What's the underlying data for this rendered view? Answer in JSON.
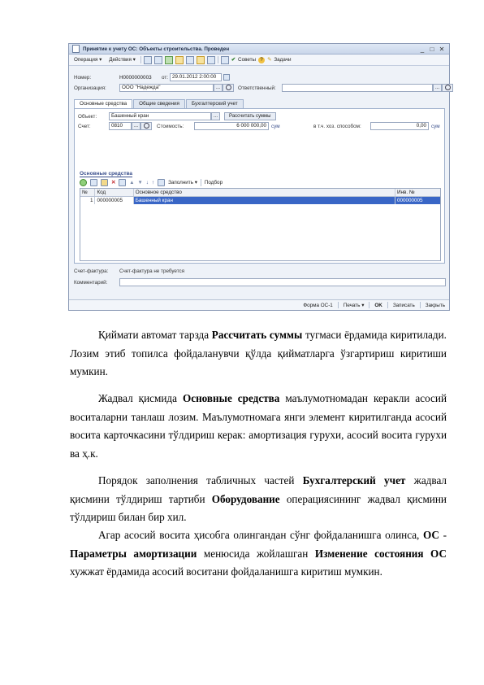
{
  "window": {
    "title": "Принятие к учету ОС: Объекты строительства. Проведен",
    "controls": [
      "_",
      "□",
      "✕"
    ]
  },
  "toolbar": {
    "operation": "Операция ▾",
    "actions": "Действия ▾",
    "advice": "Советы",
    "tasks": "Задачи"
  },
  "form": {
    "number_label": "Номер:",
    "number_value": "Н0000000003",
    "date_label": "от:",
    "date_value": "29.01.2012  2:00:00",
    "org_label": "Организация:",
    "org_value": "ООО \"Надежда\"",
    "responsible_label": "Ответственный:",
    "responsible_value": ""
  },
  "tabs": [
    "Основные средства",
    "Общие сведения",
    "Бухгалтерский учет"
  ],
  "panel": {
    "object_label": "Объект:",
    "object_value": "Башенный кран",
    "calc_button": "Рассчитать суммы",
    "account_label": "Счет:",
    "account_value": "0810",
    "cost_label": "Стоимость:",
    "cost_value": "6 000 000,00",
    "cost_currency": "сум",
    "household_label": "в т.ч. хоз. способом:",
    "household_value": "0,00",
    "household_currency": "сум",
    "section_title": "Основные средства",
    "fill_menu": "Заполнить ▾",
    "select_button": "Подбор"
  },
  "grid": {
    "headers": [
      "№",
      "Код",
      "Основное средство",
      "Инв. №"
    ],
    "rows": [
      [
        "1",
        "000000005",
        "Башенный кран",
        "000000005"
      ]
    ]
  },
  "footer_fields": {
    "invoice_label": "Счет-фактура:",
    "invoice_value": "Счет-фактура не требуется",
    "comment_label": "Комментарий:",
    "comment_value": ""
  },
  "statusbar": {
    "form": "Форма ОС-1",
    "print": "Печать ▾",
    "ok": "OK",
    "save": "Записать",
    "close": "Закрыть"
  },
  "text": {
    "p1_a": "Қиймати автомат тарзда ",
    "p1_b": "Рассчитать суммы",
    "p1_c": " тугмаси ёрдамида киритилади. Лозим этиб топилса фойдаланувчи қўлда қийматларга ўзгартириш киритиши мумкин.",
    "p2_a": "Жадвал қисмида ",
    "p2_b": "Основные средства",
    "p2_c": " маълумотномадан керакли асосий воситаларни танлаш лозим. Маълумотномага янги элемент киритилганда асосий восита карточкасини тўлдириш керак: амортизация гурухи, асосий восита гурухи ва ҳ.к.",
    "p3_a": "Порядок заполнения табличных частей ",
    "p3_b": "Бухгалтерский учет",
    "p3_c": " жадвал қисмини тўлдириш тартиби ",
    "p3_d": "Оборудование",
    "p3_e": " операциясининг жадвал қисмини тўлдириш билан бир хил.",
    "p4_a": "Агар асосий восита ҳисобга олингандан сўнг фойдаланишга олинса, ",
    "p4_b": "ОС",
    "p4_c": " - ",
    "p4_d": "Параметры амортизации",
    "p4_e": " менюсида жойлашган ",
    "p4_f": "Изменение состояния ОС",
    "p4_g": " хужжат ёрдамида асосий воситани фойдаланишга киритиш мумкин."
  }
}
